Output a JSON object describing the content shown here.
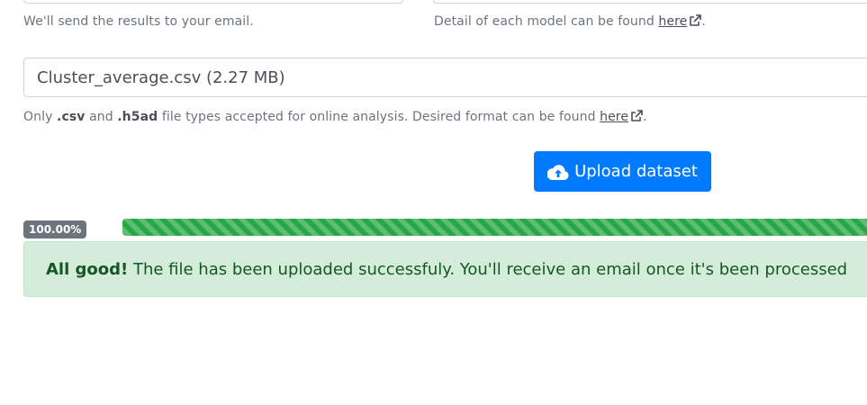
{
  "email_help": "We'll send the results to your email.",
  "model_help": {
    "text": "Detail of each model can be found ",
    "link": "here",
    "suffix": "."
  },
  "file_input": {
    "value": "Cluster_average.csv (2.27 MB)"
  },
  "file_help": {
    "prefix": "Only ",
    "ext1": ".csv",
    "and": " and ",
    "ext2": ".h5ad",
    "text": " file types accepted for online analysis. Desired format can be found ",
    "link": "here",
    "suffix": "."
  },
  "upload_button": {
    "label": "Upload dataset",
    "icon": "cloud-upload-icon"
  },
  "progress": {
    "label": "100.00%",
    "value": 1.0
  },
  "alert": {
    "strong": "All good!",
    "message": " The file has been uploaded successfuly. You'll receive an email once it's been processed"
  },
  "colors": {
    "primary": "#007bff",
    "success": "#28a745",
    "alert_bg": "#d4edda",
    "alert_text": "#155724",
    "badge": "#6c757d"
  }
}
